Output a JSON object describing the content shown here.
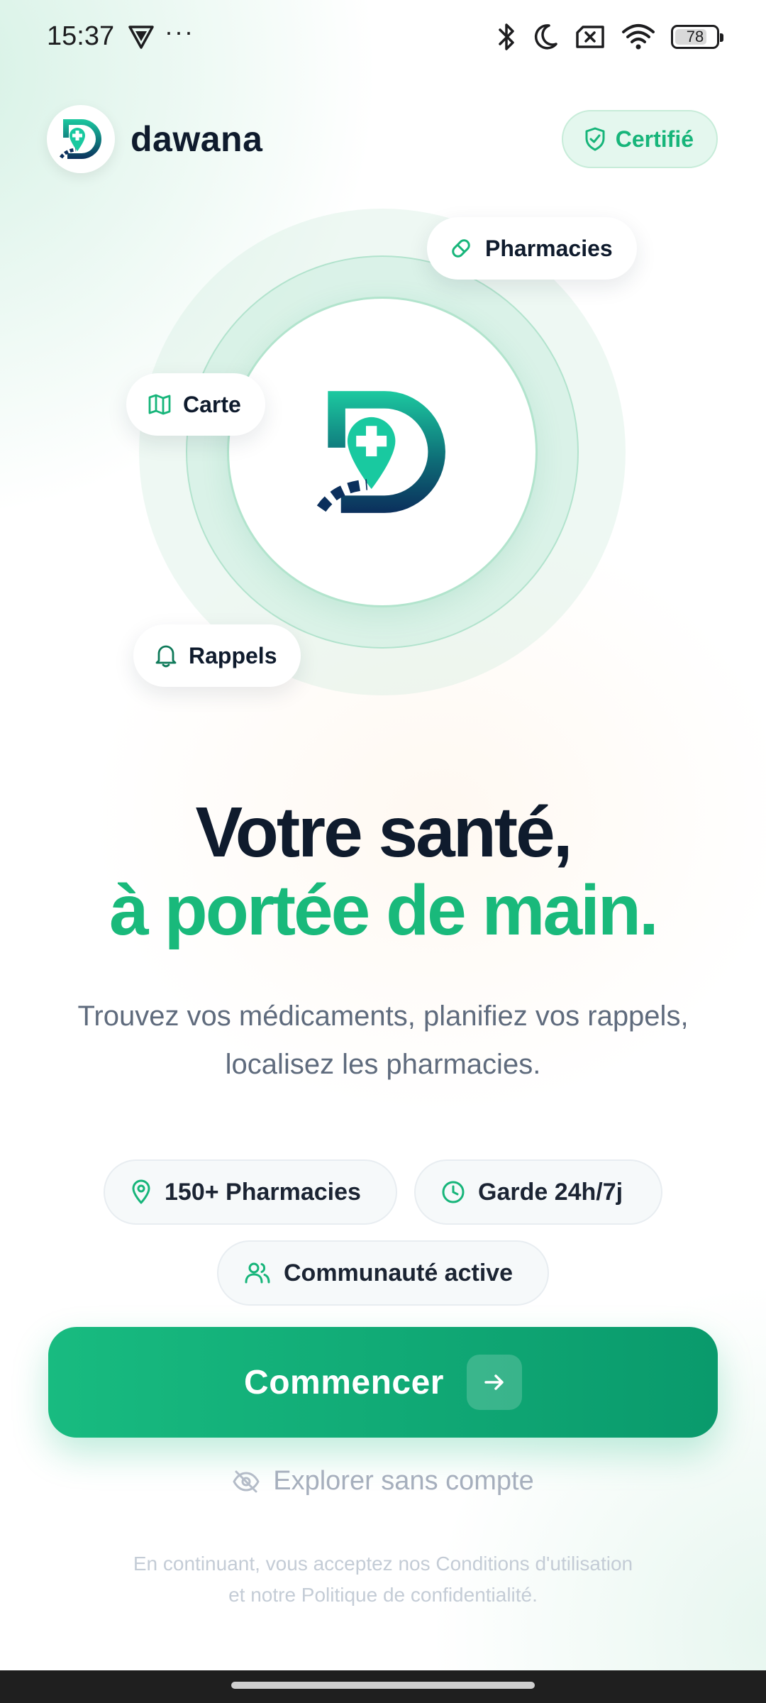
{
  "status_bar": {
    "time": "15:37",
    "overflow": "···",
    "battery": "78",
    "battery_level": 0.78,
    "icons": [
      "vpn-icon",
      "bluetooth-icon",
      "moon-icon",
      "sim-icon",
      "wifi-icon",
      "battery-icon"
    ]
  },
  "header": {
    "app_name": "dawana",
    "certified_label": "Certifié"
  },
  "hero": {
    "chips": {
      "pharmacies": "Pharmacies",
      "map": "Carte",
      "reminders": "Rappels"
    }
  },
  "headline": {
    "line1": "Votre santé,",
    "line2": "à portée de main."
  },
  "subtitle": "Trouvez vos médicaments, planifiez vos rappels, localisez les pharmacies.",
  "features": {
    "pharmacies": "150+ Pharmacies",
    "duty": "Garde 24h/7j",
    "community": "Communauté active"
  },
  "cta": {
    "label": "Commencer"
  },
  "explore": {
    "label": "Explorer sans compte"
  },
  "legal": {
    "line1": "En continuant, vous acceptez nos Conditions d'utilisation",
    "line2": "et notre Politique de confidentialité."
  },
  "colors": {
    "accent": "#19b97b",
    "accent_dark": "#0a9a6c",
    "navy": "#0f1b2d",
    "muted": "#5f6b7d"
  }
}
